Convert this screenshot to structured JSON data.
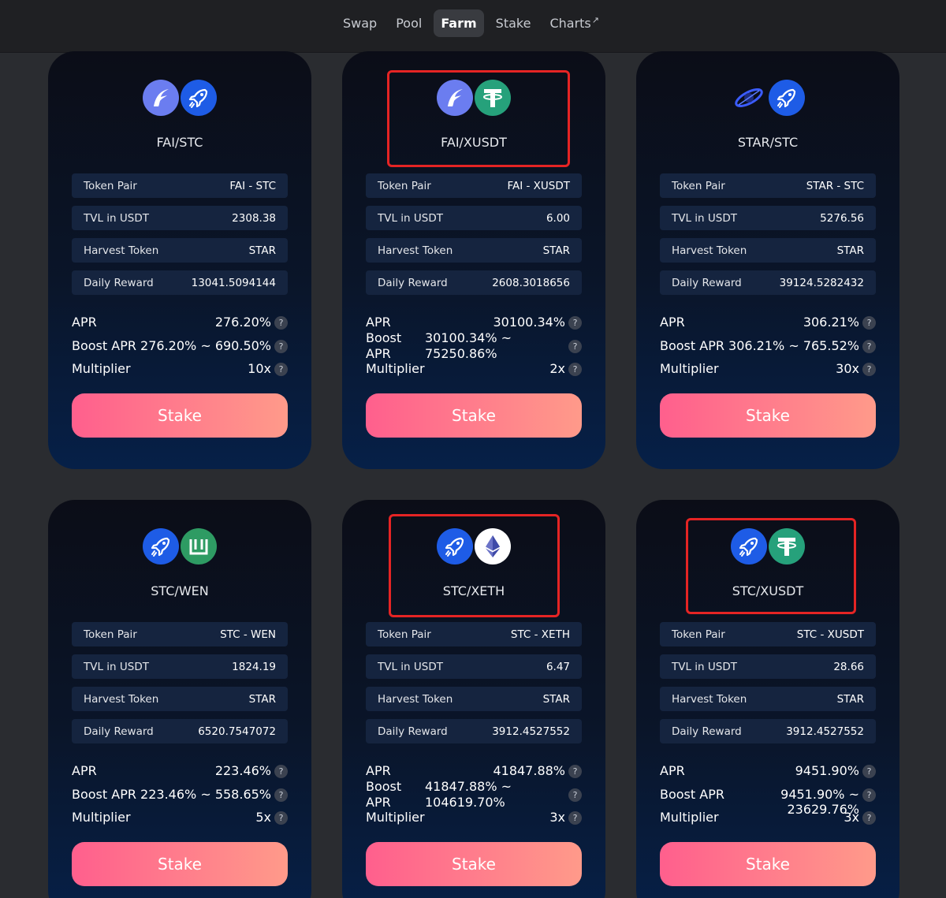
{
  "nav": {
    "items": [
      {
        "label": "Swap"
      },
      {
        "label": "Pool"
      },
      {
        "label": "Farm"
      },
      {
        "label": "Stake"
      },
      {
        "label": "Charts"
      }
    ],
    "active": "Farm",
    "external_arrow": "↗"
  },
  "labels": {
    "token_pair": "Token Pair",
    "tvl": "TVL in USDT",
    "harvest": "Harvest Token",
    "daily_reward": "Daily Reward",
    "apr": "APR",
    "boost_apr": "Boost APR",
    "boost_word": "Boost",
    "apr_word": "APR",
    "multiplier": "Multiplier",
    "stake": "Stake",
    "help": "?"
  },
  "colors": {
    "accent_gradient_start": "#ff5f8d",
    "accent_gradient_end": "#ff9a8a",
    "highlight_box": "#e52424",
    "fai": "#6b7df0",
    "stc": "#1e5ce6",
    "usdt": "#26a17b",
    "wen": "#2e9b63"
  },
  "farms": [
    {
      "name": "FAI/STC",
      "icons": [
        "fai-icon",
        "stc-rocket-icon"
      ],
      "token_pair": "FAI - STC",
      "tvl": "2308.38",
      "harvest": "STAR",
      "daily_reward": "13041.5094144",
      "apr": "276.20%",
      "boost_apr": "276.20% ~ 690.50%",
      "boost_apr_line1": "",
      "boost_apr_line2": "",
      "multiplier": "10x",
      "highlighted": false
    },
    {
      "name": "FAI/XUSDT",
      "icons": [
        "fai-icon",
        "usdt-icon"
      ],
      "token_pair": "FAI - XUSDT",
      "tvl": "6.00",
      "harvest": "STAR",
      "daily_reward": "2608.3018656",
      "apr": "30100.34%",
      "boost_apr": "",
      "boost_apr_line1": "30100.34% ~",
      "boost_apr_line2": "75250.86%",
      "multiplier": "2x",
      "highlighted": true
    },
    {
      "name": "STAR/STC",
      "icons": [
        "star-orbit-icon",
        "stc-rocket-icon"
      ],
      "token_pair": "STAR - STC",
      "tvl": "5276.56",
      "harvest": "STAR",
      "daily_reward": "39124.5282432",
      "apr": "306.21%",
      "boost_apr": "306.21% ~ 765.52%",
      "boost_apr_line1": "",
      "boost_apr_line2": "",
      "multiplier": "30x",
      "highlighted": false
    },
    {
      "name": "STC/WEN",
      "icons": [
        "stc-rocket-icon",
        "wen-icon"
      ],
      "token_pair": "STC - WEN",
      "tvl": "1824.19",
      "harvest": "STAR",
      "daily_reward": "6520.7547072",
      "apr": "223.46%",
      "boost_apr": "223.46% ~ 558.65%",
      "boost_apr_line1": "",
      "boost_apr_line2": "",
      "multiplier": "5x",
      "highlighted": false
    },
    {
      "name": "STC/XETH",
      "icons": [
        "stc-rocket-icon",
        "eth-icon"
      ],
      "token_pair": "STC - XETH",
      "tvl": "6.47",
      "harvest": "STAR",
      "daily_reward": "3912.4527552",
      "apr": "41847.88%",
      "boost_apr": "",
      "boost_apr_line1": "41847.88% ~",
      "boost_apr_line2": "104619.70%",
      "multiplier": "3x",
      "highlighted": true
    },
    {
      "name": "STC/XUSDT",
      "icons": [
        "stc-rocket-icon",
        "usdt-icon"
      ],
      "token_pair": "STC - XUSDT",
      "tvl": "28.66",
      "harvest": "STAR",
      "daily_reward": "3912.4527552",
      "apr": "9451.90%",
      "boost_apr": "9451.90% ~ 23629.76%",
      "boost_apr_line1": "",
      "boost_apr_line2": "",
      "multiplier": "3x",
      "highlighted": true
    }
  ]
}
